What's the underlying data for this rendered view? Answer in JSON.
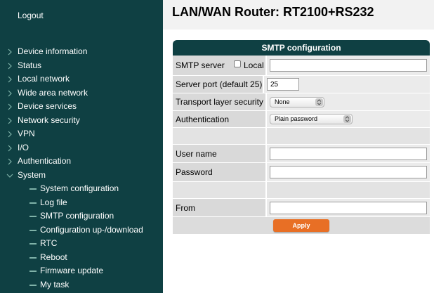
{
  "sidebar": {
    "logout": "Logout",
    "items": [
      {
        "label": "Device information"
      },
      {
        "label": "Status"
      },
      {
        "label": "Local network"
      },
      {
        "label": "Wide area network"
      },
      {
        "label": "Device services"
      },
      {
        "label": "Network security"
      },
      {
        "label": "VPN"
      },
      {
        "label": "I/O"
      },
      {
        "label": "Authentication"
      },
      {
        "label": "System",
        "expanded": true
      }
    ],
    "subitems": [
      {
        "label": "System configuration"
      },
      {
        "label": "Log file"
      },
      {
        "label": "SMTP configuration"
      },
      {
        "label": "Configuration up-/download"
      },
      {
        "label": "RTC"
      },
      {
        "label": "Reboot"
      },
      {
        "label": "Firmware update"
      },
      {
        "label": "My task"
      }
    ]
  },
  "page": {
    "title": "LAN/WAN Router: RT2100+RS232"
  },
  "panel": {
    "header": "SMTP configuration",
    "smtp_server_label": "SMTP server",
    "local_label": "Local",
    "smtp_server_value": "",
    "server_port_label": "Server port (default 25)",
    "server_port_value": "25",
    "tls_label": "Transport layer security",
    "tls_value": "None",
    "auth_label": "Authentication",
    "auth_value": "Plain password",
    "username_label": "User name",
    "username_value": "",
    "password_label": "Password",
    "password_value": "",
    "from_label": "From",
    "from_value": "",
    "apply_label": "Apply"
  },
  "colors": {
    "sidebar_bg": "#0f4043",
    "accent": "#e86f25"
  }
}
